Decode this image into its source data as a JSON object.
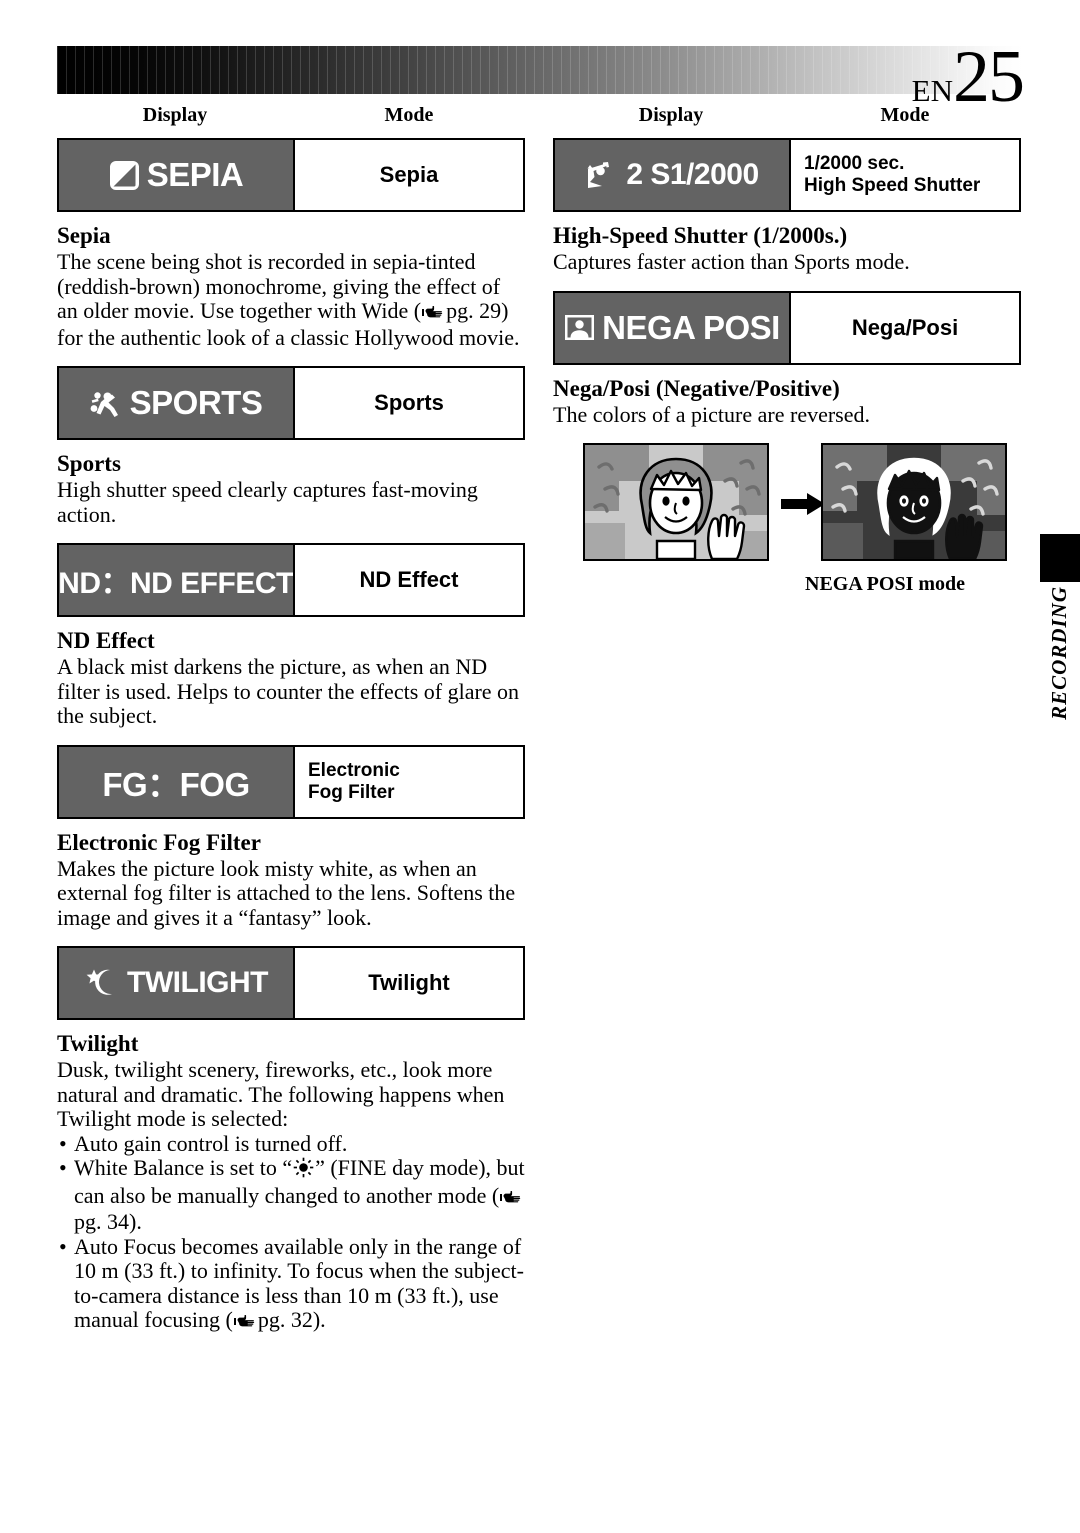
{
  "header": {
    "page_prefix": "EN",
    "page_number": "25"
  },
  "side_tab": {
    "label": "RECORDING"
  },
  "columns": {
    "left": {
      "col_headers": {
        "display": "Display",
        "mode": "Mode"
      },
      "entries": [
        {
          "display_icon": "sepia-split-square-icon",
          "display_text": "SEPIA",
          "mode_line1": "Sepia",
          "mode_line2": "",
          "heading": "Sepia",
          "body": "The scene being shot is recorded in sepia-tinted (reddish-brown) monochrome, giving the effect of an older movie. Use together with Wide (",
          "body_tail": "pg. 29) for the authentic look of a classic Hollywood movie."
        },
        {
          "display_icon": "running-person-icon",
          "display_text": "SPORTS",
          "mode_line1": "Sports",
          "mode_line2": "",
          "heading": "Sports",
          "body": "High shutter speed clearly captures fast-moving action.",
          "body_tail": ""
        },
        {
          "display_icon": "",
          "display_text": "ND：ND EFFECT",
          "mode_line1": "ND Effect",
          "mode_line2": "",
          "heading": "ND Effect",
          "body": "A black mist darkens the picture, as when an ND filter is used. Helps to counter the effects of glare on the subject.",
          "body_tail": ""
        },
        {
          "display_icon": "",
          "display_text": "FG：FOG",
          "mode_line1": "Electronic",
          "mode_line2": "Fog Filter",
          "heading": "Electronic Fog Filter",
          "body": "Makes the picture look misty white, as when an external fog filter is attached to the lens. Softens the image and gives it a “fantasy” look.",
          "body_tail": ""
        },
        {
          "display_icon": "star-moon-icon",
          "display_text": "TWILIGHT",
          "mode_line1": "Twilight",
          "mode_line2": "",
          "heading": "Twilight",
          "body": "Dusk, twilight scenery, fireworks, etc., look more natural and dramatic. The following happens when Twilight mode is selected:",
          "body_tail": ""
        }
      ],
      "twilight_bullets": [
        {
          "pre": "Auto gain control is turned off.",
          "mid": "",
          "post": ""
        },
        {
          "pre": "White Balance is set to “",
          "mid": "” (FINE day mode), but can also be manually changed to another mode (",
          "post": "pg. 34)."
        },
        {
          "pre": "Auto Focus becomes available only in the range of 10 m (33 ft.) to infinity. To focus when the subject-to-camera distance is less than 10 m (33 ft.), use manual focusing (",
          "mid": "",
          "post": "pg. 32)."
        }
      ]
    },
    "right": {
      "col_headers": {
        "display": "Display",
        "mode": "Mode"
      },
      "entries": [
        {
          "display_icon": "high-speed-shutter-figure-icon",
          "display_text": "2 S1/2000",
          "mode_line1": "1/2000 sec.",
          "mode_line2": "High Speed Shutter",
          "heading": "High-Speed Shutter (1/2000s.)",
          "body": "Captures faster action than Sports mode.",
          "body_tail": ""
        },
        {
          "display_icon": "portrait-frame-icon",
          "display_text": "NEGA POSI",
          "mode_line1": "Nega/Posi",
          "mode_line2": "",
          "heading": "Nega/Posi (Negative/Positive)",
          "body": "The colors of a picture are reversed.",
          "body_tail": ""
        }
      ],
      "illustration": {
        "caption": "NEGA POSI mode",
        "left_panel_name": "normal-picture-panel",
        "right_panel_name": "negative-picture-panel",
        "arrow_name": "right-arrow-icon"
      }
    }
  }
}
